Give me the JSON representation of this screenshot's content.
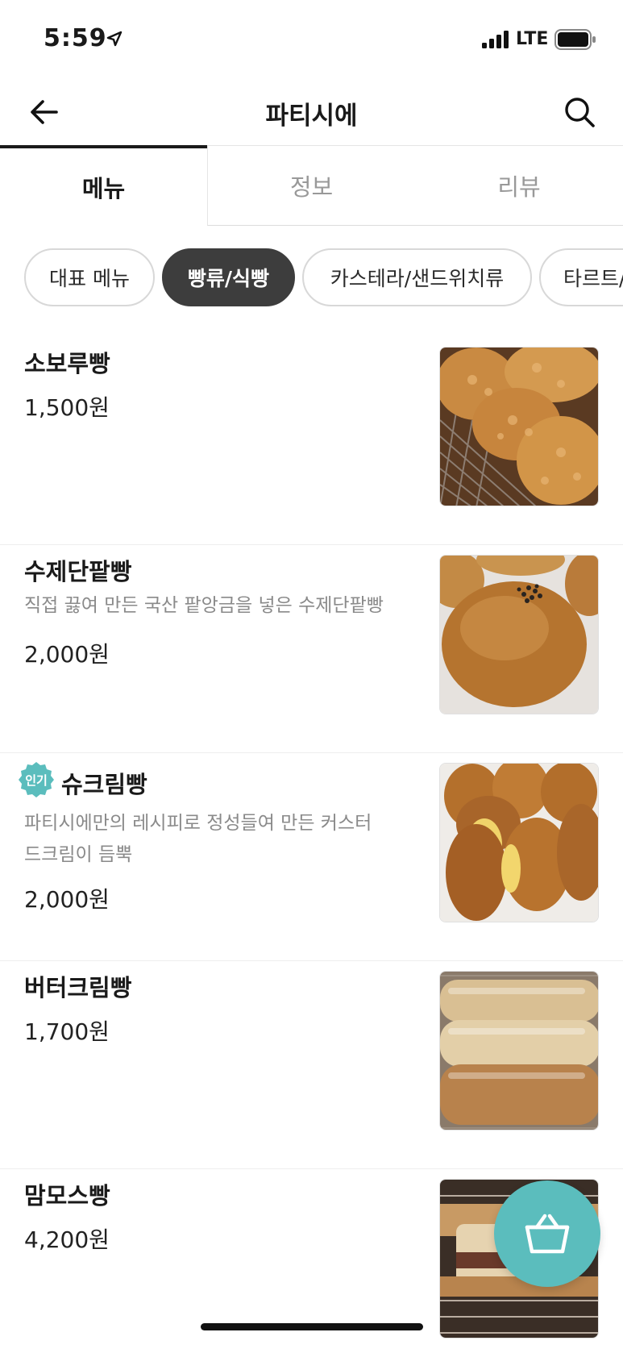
{
  "status_bar": {
    "time": "5:59",
    "network": "LTE"
  },
  "header": {
    "title": "파티시에"
  },
  "tabs": [
    {
      "label": "메뉴",
      "active": true
    },
    {
      "label": "정보",
      "active": false
    },
    {
      "label": "리뷰",
      "active": false
    }
  ],
  "categories": [
    {
      "label": "대표 메뉴",
      "active": false
    },
    {
      "label": "빵류/식빵",
      "active": true
    },
    {
      "label": "카스테라/샌드위치류",
      "active": false
    },
    {
      "label": "타르트/",
      "active": false
    }
  ],
  "menu": [
    {
      "name": "소보루빵",
      "desc": "",
      "price": "1,500원",
      "badge": ""
    },
    {
      "name": "수제단팥빵",
      "desc": "직접 끓여 만든 국산 팥앙금을 넣은 수제단팥빵",
      "price": "2,000원",
      "badge": ""
    },
    {
      "name": "슈크림빵",
      "desc_line1": "파티시에만의 레시피로 정성들여 만든 커스터",
      "desc_line2": "드크림이 듬뿍",
      "price": "2,000원",
      "badge": "인기"
    },
    {
      "name": "버터크림빵",
      "desc": "",
      "price": "1,700원",
      "badge": ""
    },
    {
      "name": "맘모스빵",
      "desc": "",
      "price": "4,200원",
      "badge": ""
    }
  ],
  "colors": {
    "accent_teal": "#5bbdbd",
    "chip_active": "#3d3d3d",
    "text_muted": "#8a8a8a"
  },
  "icons": [
    "location-arrow-icon",
    "signal-icon",
    "battery-icon",
    "back-arrow-icon",
    "search-icon",
    "shopping-basket-icon"
  ]
}
